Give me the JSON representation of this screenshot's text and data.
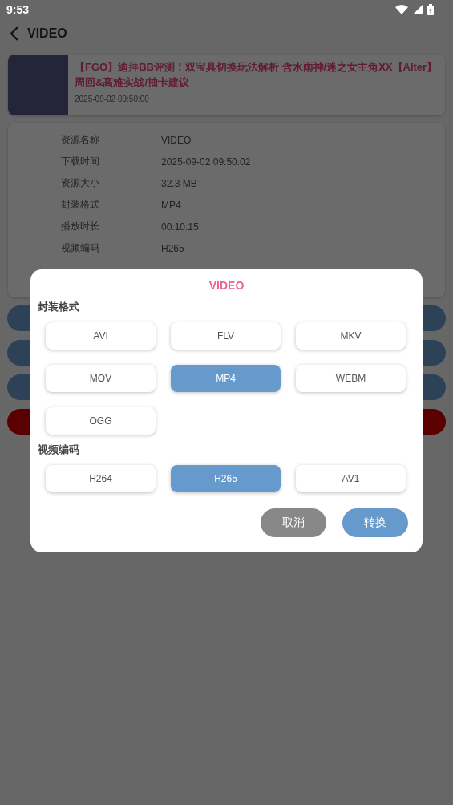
{
  "status_bar": {
    "time": "9:53"
  },
  "header": {
    "title": "VIDEO"
  },
  "video_card": {
    "title": "【FGO】迪拜BB评测！双宝具切换玩法解析 含水雨神/迷之女主角XX【Alter】周回&高难实战/抽卡建议",
    "date": "2025-09-02 09:50:00"
  },
  "details": [
    {
      "label": "资源名称",
      "value": "VIDEO"
    },
    {
      "label": "下载时间",
      "value": "2025-09-02 09:50:02"
    },
    {
      "label": "资源大小",
      "value": "32.3 MB"
    },
    {
      "label": "封装格式",
      "value": "MP4"
    },
    {
      "label": "播放时长",
      "value": "00:10:15"
    },
    {
      "label": "视频编码",
      "value": "H265"
    }
  ],
  "action_buttons": [
    {
      "kind": "primary"
    },
    {
      "kind": "primary"
    },
    {
      "kind": "primary"
    },
    {
      "kind": "danger"
    }
  ],
  "dialog": {
    "title": "VIDEO",
    "sections": [
      {
        "label": "封装格式",
        "options": [
          {
            "label": "AVI",
            "selected": false
          },
          {
            "label": "FLV",
            "selected": false
          },
          {
            "label": "MKV",
            "selected": false
          },
          {
            "label": "MOV",
            "selected": false
          },
          {
            "label": "MP4",
            "selected": true
          },
          {
            "label": "WEBM",
            "selected": false
          },
          {
            "label": "OGG",
            "selected": false
          }
        ]
      },
      {
        "label": "视频编码",
        "options": [
          {
            "label": "H264",
            "selected": false
          },
          {
            "label": "H265",
            "selected": true
          },
          {
            "label": "AV1",
            "selected": false
          }
        ]
      }
    ],
    "buttons": [
      {
        "label": "取消",
        "kind": "cancel"
      },
      {
        "label": "转换",
        "kind": "confirm"
      }
    ]
  }
}
